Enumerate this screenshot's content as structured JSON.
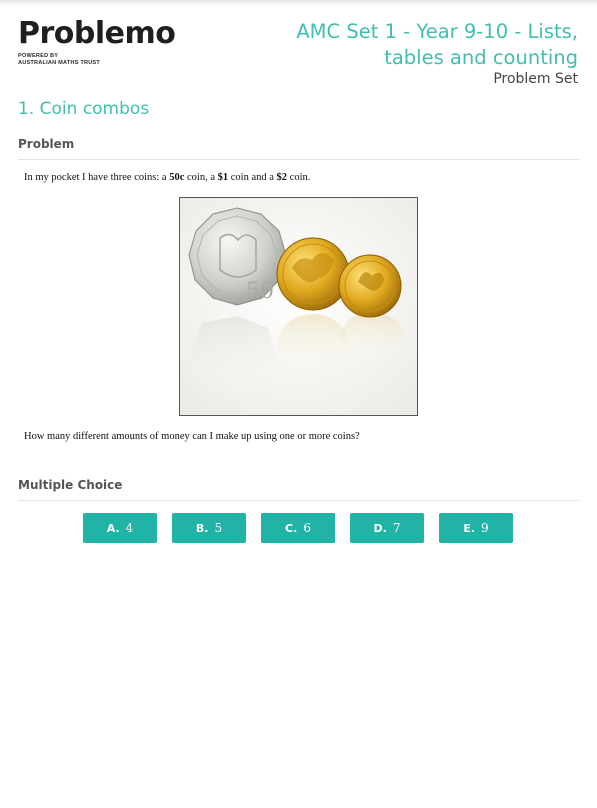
{
  "header": {
    "logo_text": "Problemo",
    "logo_sub_line1": "POWERED BY",
    "logo_sub_line2": "AUSTRALIAN MATHS TRUST",
    "set_title_line1": "AMC Set 1 - Year 9-10 - Lists,",
    "set_title_line2": "tables and counting",
    "set_subtitle": "Problem Set"
  },
  "question": {
    "number": "1.",
    "title": "Coin combos",
    "problem_heading": "Problem",
    "intro_parts": [
      "In my pocket I have three coins: a ",
      "50c",
      " coin, a ",
      "$1",
      " coin and a ",
      "$2",
      " coin."
    ],
    "prompt": "How many different amounts of money can I make up using one or more coins?",
    "image_alt": "Australian coins: 50c, $1 and $2"
  },
  "multiple_choice": {
    "heading": "Multiple Choice",
    "options": [
      {
        "letter": "A.",
        "value": "4"
      },
      {
        "letter": "B.",
        "value": "5"
      },
      {
        "letter": "C.",
        "value": "6"
      },
      {
        "letter": "D.",
        "value": "7"
      },
      {
        "letter": "E.",
        "value": "9"
      }
    ]
  },
  "colors": {
    "accent": "#3fbfb0",
    "button": "#21b3a5"
  }
}
